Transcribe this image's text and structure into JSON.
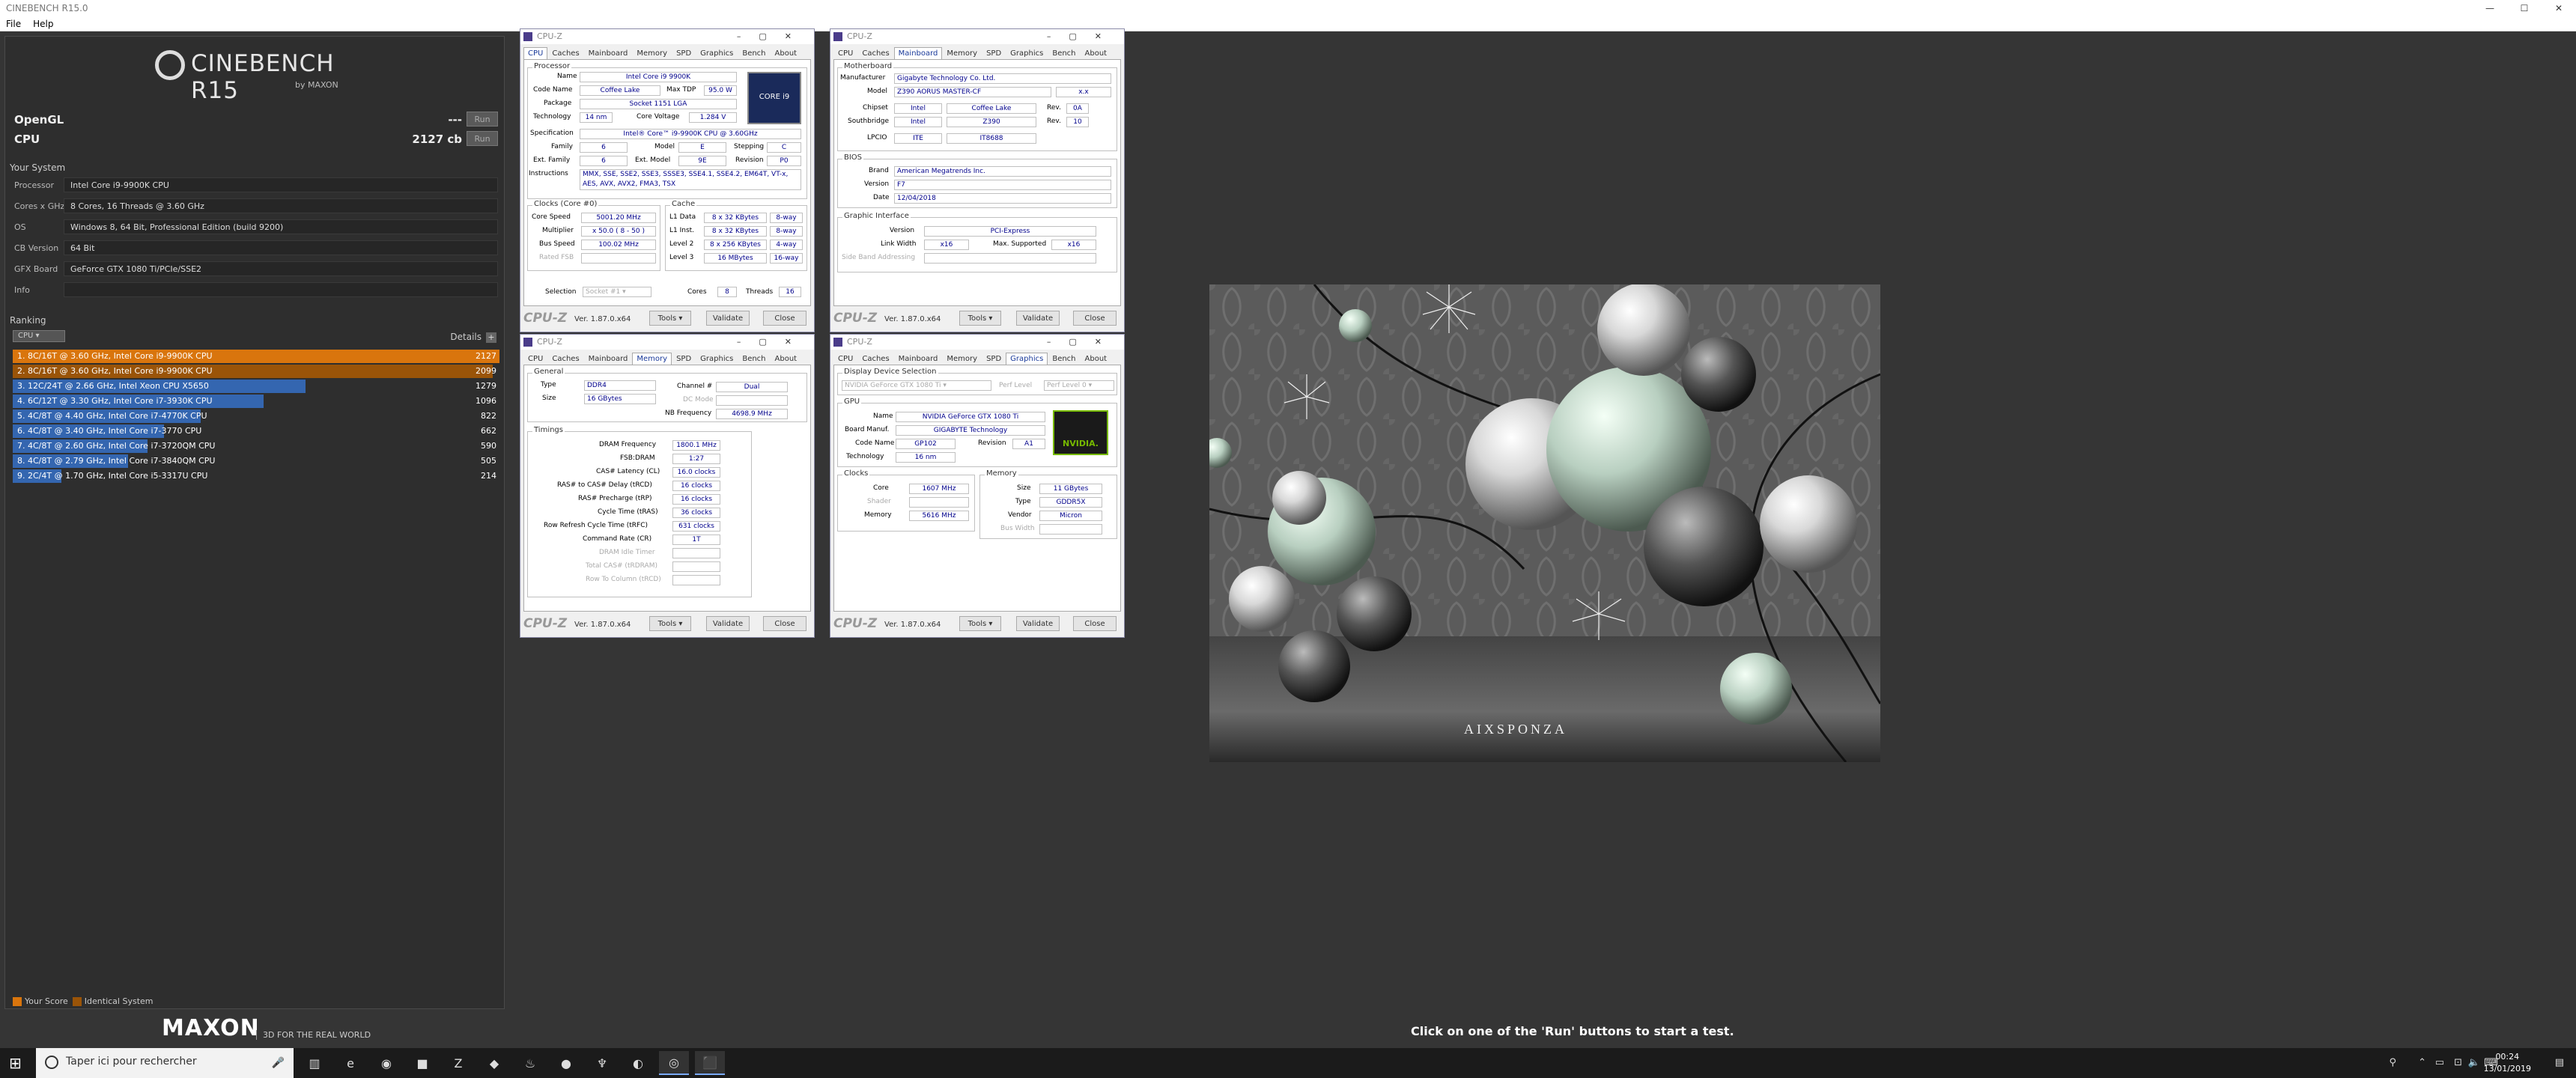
{
  "window": {
    "title": "CINEBENCH R15.0",
    "controls": [
      "—",
      "☐",
      "✕"
    ]
  },
  "menu": [
    "File",
    "Help"
  ],
  "logo": {
    "text": "CINEBENCH R15",
    "by": "by MAXON"
  },
  "tests": [
    {
      "label": "OpenGL",
      "score": "---",
      "run": "Run"
    },
    {
      "label": "CPU",
      "score": "2127 cb",
      "run": "Run"
    }
  ],
  "system": {
    "heading": "Your System",
    "rows": [
      {
        "k": "Processor",
        "v": "Intel Core i9-9900K CPU"
      },
      {
        "k": "Cores x GHz",
        "v": "8 Cores, 16 Threads @ 3.60 GHz"
      },
      {
        "k": "OS",
        "v": "Windows 8, 64 Bit, Professional Edition (build 9200)"
      },
      {
        "k": "CB Version",
        "v": "64 Bit"
      },
      {
        "k": "GFX Board",
        "v": "GeForce GTX 1080 Ti/PCIe/SSE2"
      },
      {
        "k": "Info",
        "v": ""
      }
    ]
  },
  "ranking": {
    "heading": "Ranking",
    "select": "CPU",
    "details": "Details",
    "max": 2127,
    "rows": [
      {
        "label": "1. 8C/16T @ 3.60 GHz, Intel Core i9-9900K CPU",
        "value": 2127,
        "color": "#d9750d"
      },
      {
        "label": "2. 8C/16T @ 3.60 GHz, Intel Core i9-9900K CPU",
        "value": 2099,
        "color": "#9a5408"
      },
      {
        "label": "3. 12C/24T @ 2.66 GHz, Intel Xeon CPU X5650",
        "value": 1279,
        "color": "#3466b0"
      },
      {
        "label": "4. 6C/12T @ 3.30 GHz,  Intel Core i7-3930K CPU",
        "value": 1096,
        "color": "#3466b0"
      },
      {
        "label": "5. 4C/8T @ 4.40 GHz, Intel Core i7-4770K CPU",
        "value": 822,
        "color": "#3466b0"
      },
      {
        "label": "6. 4C/8T @ 3.40 GHz,  Intel Core i7-3770 CPU",
        "value": 662,
        "color": "#3466b0"
      },
      {
        "label": "7. 4C/8T @ 2.60 GHz, Intel Core i7-3720QM CPU",
        "value": 590,
        "color": "#3466b0"
      },
      {
        "label": "8. 4C/8T @ 2.79 GHz,  Intel Core i7-3840QM CPU",
        "value": 505,
        "color": "#3466b0"
      },
      {
        "label": "9. 2C/4T @ 1.70 GHz,  Intel Core i5-3317U CPU",
        "value": 214,
        "color": "#3466b0"
      }
    ],
    "legend": [
      {
        "label": "Your Score",
        "color": "#d9750d"
      },
      {
        "label": "Identical System",
        "color": "#9a5408"
      }
    ]
  },
  "footer": {
    "brand": "MAXON",
    "tag": "3D FOR THE REAL WORLD"
  },
  "status": "Click on one of the 'Run' buttons to start a test.",
  "render": {
    "watermark": "AIXSPONZA"
  },
  "cpuz_common": {
    "title": "CPU-Z",
    "tabs": [
      "CPU",
      "Caches",
      "Mainboard",
      "Memory",
      "SPD",
      "Graphics",
      "Bench",
      "About"
    ],
    "brand": "CPU-Z",
    "ver": "Ver. 1.87.0.x64",
    "tools": "Tools",
    "validate": "Validate",
    "close": "Close"
  },
  "cpuz_cpu": {
    "processor": "Processor",
    "name_l": "Name",
    "name": "Intel Core i9 9900K",
    "codename_l": "Code Name",
    "codename": "Coffee Lake",
    "maxtdp_l": "Max TDP",
    "maxtdp": "95.0 W",
    "package_l": "Package",
    "package": "Socket 1151 LGA",
    "tech_l": "Technology",
    "tech": "14 nm",
    "voltage_l": "Core Voltage",
    "voltage": "1.284 V",
    "spec_l": "Specification",
    "spec": "Intel® Core™ i9-9900K CPU @ 3.60GHz",
    "family_l": "Family",
    "family": "6",
    "model_l": "Model",
    "model": "E",
    "stepping_l": "Stepping",
    "stepping": "C",
    "extfam_l": "Ext. Family",
    "extfam": "6",
    "extmod_l": "Ext. Model",
    "extmod": "9E",
    "rev_l": "Revision",
    "rev": "P0",
    "instr_l": "Instructions",
    "instr": "MMX, SSE, SSE2, SSE3, SSSE3, SSE4.1, SSE4.2, EM64T, VT-x, AES, AVX, AVX2, FMA3, TSX",
    "clocks": "Clocks (Core #0)",
    "cs_l": "Core Speed",
    "cs": "5001.20 MHz",
    "mult_l": "Multiplier",
    "mult": "x 50.0 ( 8 - 50 )",
    "bus_l": "Bus Speed",
    "bus": "100.02 MHz",
    "fsb_l": "Rated FSB",
    "cache": "Cache",
    "l1d_l": "L1 Data",
    "l1d": "8 x 32 KBytes",
    "l1d_w": "8-way",
    "l1i_l": "L1 Inst.",
    "l1i": "8 x 32 KBytes",
    "l1i_w": "8-way",
    "l2_l": "Level 2",
    "l2": "8 x 256 KBytes",
    "l2_w": "4-way",
    "l3_l": "Level 3",
    "l3": "16 MBytes",
    "l3_w": "16-way",
    "sel_l": "Selection",
    "sel": "Socket #1",
    "cores_l": "Cores",
    "cores": "8",
    "threads_l": "Threads",
    "threads": "16",
    "badge": "CORE i9"
  },
  "cpuz_mb": {
    "mb": "Motherboard",
    "manu_l": "Manufacturer",
    "manu": "Gigabyte Technology Co. Ltd.",
    "model_l": "Model",
    "model": "Z390 AORUS MASTER-CF",
    "model_r": "x.x",
    "chip_l": "Chipset",
    "chip": "Intel",
    "chip2": "Coffee Lake",
    "chiprev_l": "Rev.",
    "chiprev": "0A",
    "sb_l": "Southbridge",
    "sb": "Intel",
    "sb2": "Z390",
    "sbrev_l": "Rev.",
    "sbrev": "10",
    "lpc_l": "LPCIO",
    "lpc": "ITE",
    "lpc2": "IT8688",
    "bios": "BIOS",
    "brand_l": "Brand",
    "brand": "American Megatrends Inc.",
    "ver_l": "Version",
    "ver": "F7",
    "date_l": "Date",
    "date": "12/04/2018",
    "gi": "Graphic Interface",
    "giv_l": "Version",
    "giv": "PCI-Express",
    "lw_l": "Link Width",
    "lw": "x16",
    "ms_l": "Max. Supported",
    "ms": "x16",
    "sba_l": "Side Band Addressing"
  },
  "cpuz_mem": {
    "general": "General",
    "type_l": "Type",
    "type": "DDR4",
    "ch_l": "Channel #",
    "ch": "Dual",
    "size_l": "Size",
    "size": "16 GBytes",
    "dc_l": "DC Mode",
    "nb_l": "NB Frequency",
    "nb": "4698.9 MHz",
    "timings": "Timings",
    "dram_l": "DRAM Frequency",
    "dram": "1800.1 MHz",
    "fsbd_l": "FSB:DRAM",
    "fsbd": "1:27",
    "cl_l": "CAS# Latency (CL)",
    "cl": "16.0 clocks",
    "rcd_l": "RAS# to CAS# Delay (tRCD)",
    "rcd": "16 clocks",
    "rp_l": "RAS# Precharge (tRP)",
    "rp": "16 clocks",
    "ras_l": "Cycle Time (tRAS)",
    "ras": "36 clocks",
    "rfc_l": "Row Refresh Cycle Time (tRFC)",
    "rfc": "631 clocks",
    "cr_l": "Command Rate (CR)",
    "cr": "1T",
    "idle_l": "DRAM Idle Timer",
    "tcas_l": "Total CAS# (tRDRAM)",
    "rtc_l": "Row To Column (tRCD)"
  },
  "cpuz_gfx": {
    "dds": "Display Device Selection",
    "dev": "NVIDIA GeForce GTX 1080 Ti",
    "perf_l": "Perf Level",
    "perf": "Perf Level 0",
    "gpu": "GPU",
    "name_l": "Name",
    "name": "NVIDIA GeForce GTX 1080 Ti",
    "bm_l": "Board Manuf.",
    "bm": "GIGABYTE Technology",
    "cn_l": "Code Name",
    "cn": "GP102",
    "rev_l": "Revision",
    "rev": "A1",
    "tech_l": "Technology",
    "tech": "16 nm",
    "clocks": "Clocks",
    "core_l": "Core",
    "core": "1607 MHz",
    "shader_l": "Shader",
    "memc_l": "Memory",
    "memc": "5616 MHz",
    "memory": "Memory",
    "msize_l": "Size",
    "msize": "11 GBytes",
    "mtype_l": "Type",
    "mtype": "GDDR5X",
    "vendor_l": "Vendor",
    "vendor": "Micron",
    "bw_l": "Bus Width",
    "logo": "NVIDIA."
  },
  "taskbar": {
    "search": "Taper ici pour rechercher",
    "time": "00:24",
    "date": "13/01/2019",
    "apps": [
      "▥",
      "e",
      "◉",
      "■",
      "Z",
      "◆",
      "♨",
      "●",
      "♆",
      "◐",
      "◎",
      "⬛"
    ]
  }
}
